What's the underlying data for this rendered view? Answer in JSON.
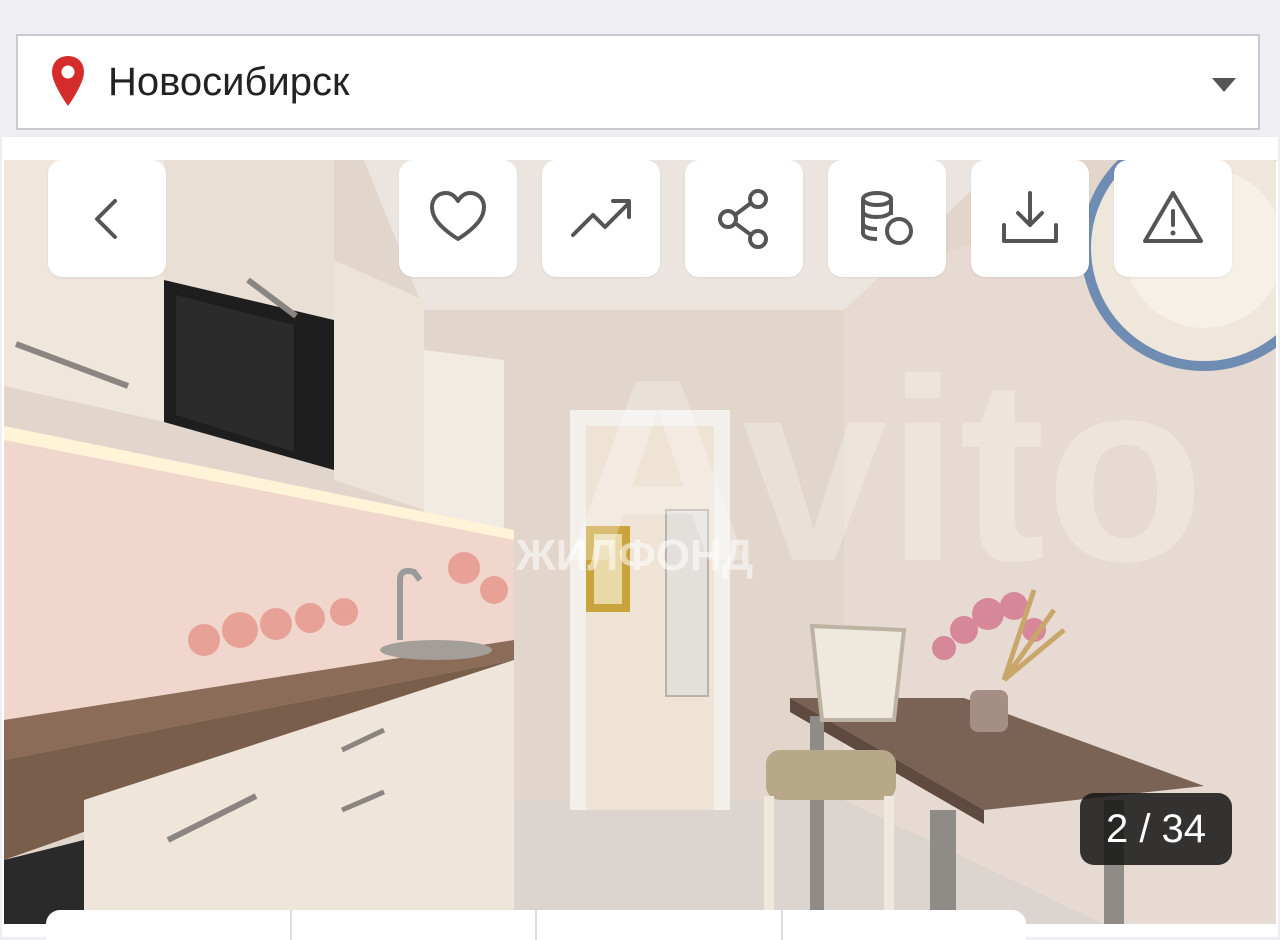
{
  "location": {
    "city": "Новосибирск",
    "pin_icon": "map-pin-icon",
    "pin_color": "#d42b2b",
    "dropdown_icon": "chevron-down-icon"
  },
  "gallery": {
    "counter": "2 / 34",
    "current": 2,
    "total": 34,
    "watermark_main": "Avito",
    "watermark_sub": "ЖИЛФОНД",
    "toolbar": [
      {
        "name": "back",
        "icon": "chevron-left-icon"
      },
      {
        "name": "favorite",
        "icon": "heart-icon"
      },
      {
        "name": "price-history",
        "icon": "trend-up-icon"
      },
      {
        "name": "share",
        "icon": "share-icon"
      },
      {
        "name": "mortgage",
        "icon": "coins-icon"
      },
      {
        "name": "download",
        "icon": "download-icon"
      },
      {
        "name": "report",
        "icon": "warning-icon"
      }
    ]
  }
}
